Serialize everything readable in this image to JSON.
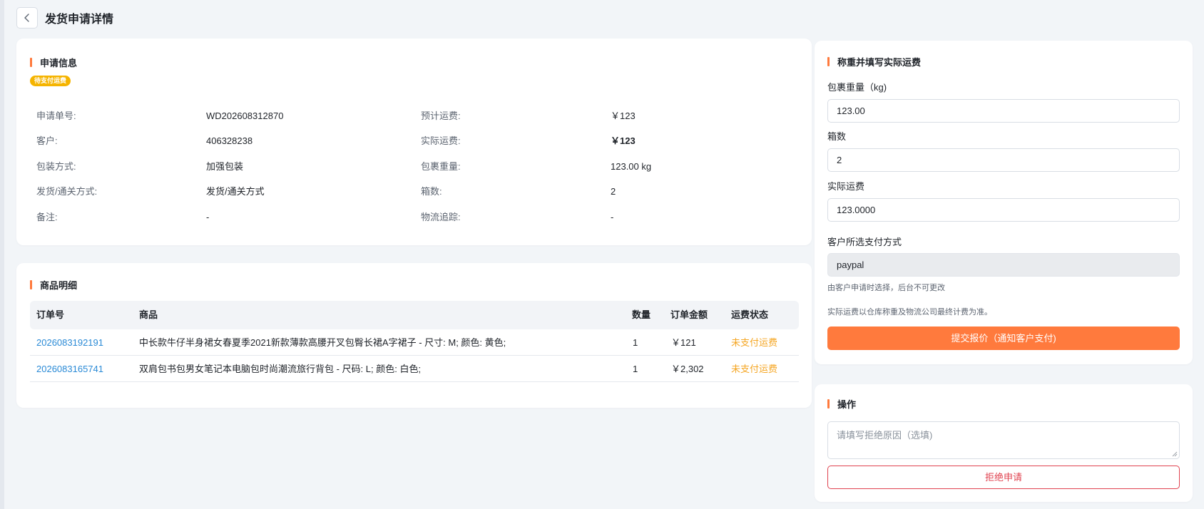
{
  "header": {
    "title": "发货申请详情"
  },
  "icons": {
    "back": "chevron-left-icon"
  },
  "colors": {
    "accent": "#ff7a3d",
    "link": "#2a8ad6",
    "status_unpaid": "#f5a623",
    "badge": "#f5b400",
    "danger": "#e0424f"
  },
  "apply_info": {
    "title": "申请信息",
    "badge": "待支付运费",
    "left": [
      {
        "label": "申请单号:",
        "value": "WD202608312870"
      },
      {
        "label": "客户:",
        "value": "406328238"
      },
      {
        "label": "包装方式:",
        "value": "加强包装"
      },
      {
        "label": "发货/通关方式:",
        "value": "发货/通关方式"
      },
      {
        "label": "备注:",
        "value": "-"
      }
    ],
    "right": [
      {
        "label": "预计运费:",
        "value": "￥123"
      },
      {
        "label": "实际运费:",
        "value": "￥123"
      },
      {
        "label": "包裹重量:",
        "value": "123.00 kg"
      },
      {
        "label": "箱数:",
        "value": "2"
      },
      {
        "label": "物流追踪:",
        "value": "-"
      }
    ]
  },
  "goods": {
    "title": "商品明细",
    "columns": [
      "订单号",
      "商品",
      "数量",
      "订单金额",
      "运费状态"
    ],
    "rows": [
      {
        "order_no": "2026083192191",
        "product": "中长款牛仔半身裙女春夏季2021新款薄款高腰开叉包臀长裙A字裙子 - 尺寸: M; 颜色: 黄色;",
        "qty": "1",
        "amount": "￥121",
        "status": "未支付运费"
      },
      {
        "order_no": "2026083165741",
        "product": "双肩包书包男女笔记本电脑包时尚潮流旅行背包 - 尺码: L; 颜色: 白色;",
        "qty": "1",
        "amount": "￥2,302",
        "status": "未支付运费"
      }
    ]
  },
  "weigh": {
    "title": "称重并填写实际运费",
    "weight_label": "包裹重量（kg)",
    "weight_value": "123.00",
    "boxes_label": "箱数",
    "boxes_value": "2",
    "freight_label": "实际运费",
    "freight_value": "123.0000",
    "payment_label": "客户所选支付方式",
    "payment_value": "paypal",
    "payment_hint": "由客户申请时选择，后台不可更改",
    "freight_hint": "实际运费以仓库称重及物流公司最终计费为准。",
    "submit_label": "提交报价（通知客户支付)"
  },
  "actions": {
    "title": "操作",
    "reason_placeholder": "请填写拒绝原因（选填)",
    "reject_label": "拒绝申请"
  }
}
